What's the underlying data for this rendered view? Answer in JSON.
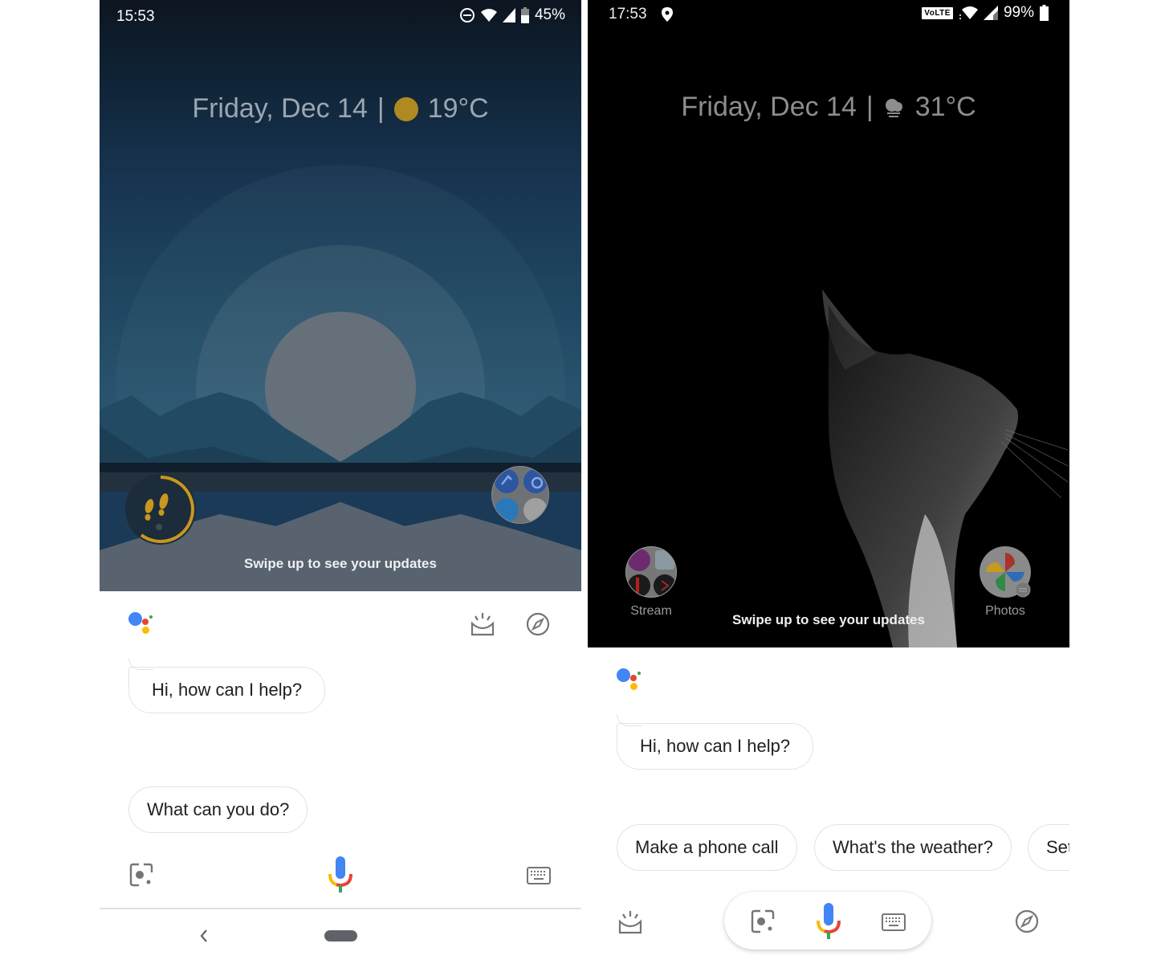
{
  "left_screen": {
    "status_bar": {
      "time": "15:53",
      "icons": [
        "do-not-disturb-icon",
        "wifi-icon",
        "cell-signal-icon",
        "battery-icon"
      ],
      "battery": "45%"
    },
    "glance": {
      "date": "Friday, Dec 14",
      "separator": "|",
      "weather_icon": "sunny-icon",
      "temperature": "19°C"
    },
    "wallpaper": "mountain-lake-sunrise",
    "shortcuts": [
      {
        "name": "Fit",
        "icon": "footsteps-icon",
        "label": ""
      },
      {
        "name": "Assistant apps",
        "icon": "app-folder-icon",
        "label": ""
      }
    ],
    "swipe_hint": "Swipe up to see your updates",
    "assistant": {
      "logo": "google-assistant-dots",
      "top_icons": [
        "updates-inbox-icon",
        "explore-compass-icon"
      ],
      "greeting": "Hi, how can I help?",
      "suggestions": [
        "What can you do?"
      ],
      "bottom_bar": [
        "lens-icon",
        "mic-icon",
        "keyboard-icon"
      ]
    },
    "navigation": [
      "back-icon",
      "home-pill"
    ]
  },
  "right_screen": {
    "status_bar": {
      "time": "17:53",
      "left_icons": [
        "location-pin-icon"
      ],
      "volte": "VoLTE",
      "icons": [
        "wifi-icon",
        "cell-signal-icon"
      ],
      "battery": "99%"
    },
    "glance": {
      "date": "Friday, Dec 14",
      "separator": "|",
      "weather_icon": "cloudy-haze-icon",
      "temperature": "31°C"
    },
    "wallpaper": "cat-silhouette-dark",
    "shortcuts": [
      {
        "name": "Stream",
        "icon": "app-folder-icon",
        "label": "Stream"
      },
      {
        "name": "Photos",
        "icon": "google-photos-icon",
        "label": "Photos"
      }
    ],
    "swipe_hint": "Swipe up to see your updates",
    "assistant": {
      "logo": "google-assistant-dots",
      "greeting": "Hi, how can I help?",
      "suggestions": [
        "Make a phone call",
        "What's the weather?",
        "Set"
      ],
      "bottom_bar": [
        "updates-inbox-icon",
        "lens-icon",
        "mic-icon",
        "keyboard-icon",
        "explore-compass-icon"
      ]
    }
  },
  "colors": {
    "google_blue": "#4285f4",
    "google_red": "#ea4335",
    "google_yellow": "#fbbc05",
    "google_green": "#34a853",
    "icon_gray": "#757575",
    "fit_gold": "#c8971f"
  }
}
